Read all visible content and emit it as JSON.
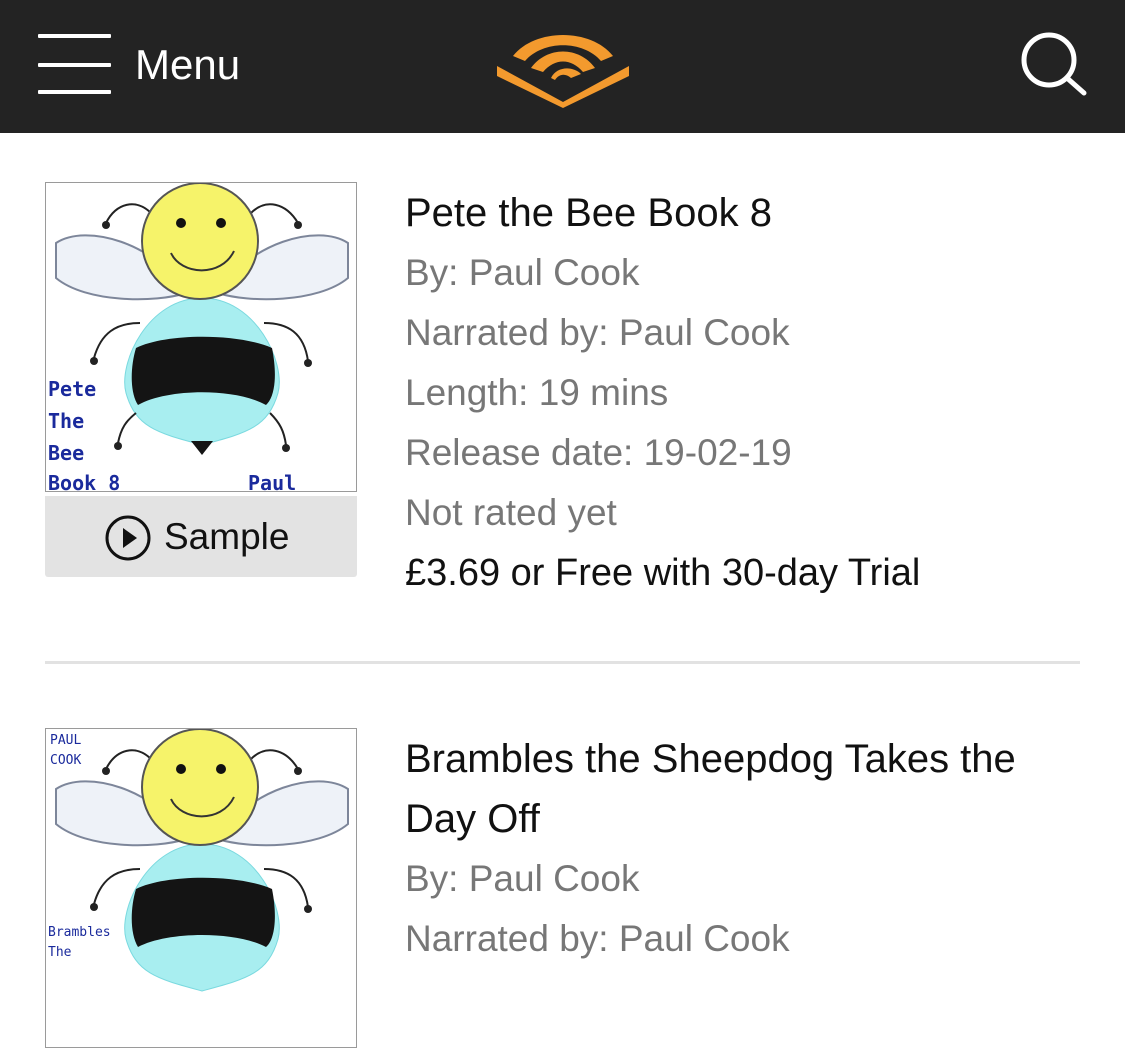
{
  "header": {
    "menu_label": "Menu",
    "logo_color": "#F39A2E"
  },
  "books": [
    {
      "title": "Pete the Bee Book 8",
      "author": "By: Paul Cook",
      "narrator": "Narrated by: Paul Cook",
      "length": "Length: 19 mins",
      "release_date": "Release date: 19-02-19",
      "rating": "Not rated yet",
      "price": "£3.69 or Free with 30-day Trial",
      "sample_label": "Sample",
      "cover": {
        "title_lines": [
          "Pete",
          "The",
          "Bee",
          "Book 8"
        ],
        "author": "Paul Cook"
      }
    },
    {
      "title": "Brambles the Sheepdog Takes the Day Off",
      "author": "By: Paul Cook",
      "narrator": "Narrated by: Paul Cook",
      "cover": {
        "author_lines": [
          "PAUL",
          "COOK"
        ],
        "title_lines": [
          "Brambles",
          "The"
        ]
      }
    }
  ],
  "colors": {
    "header_bg": "#232323",
    "sample_bg": "#e3e3e3",
    "bee_face": "#f6f36a",
    "bee_body": "#a8eef0"
  }
}
